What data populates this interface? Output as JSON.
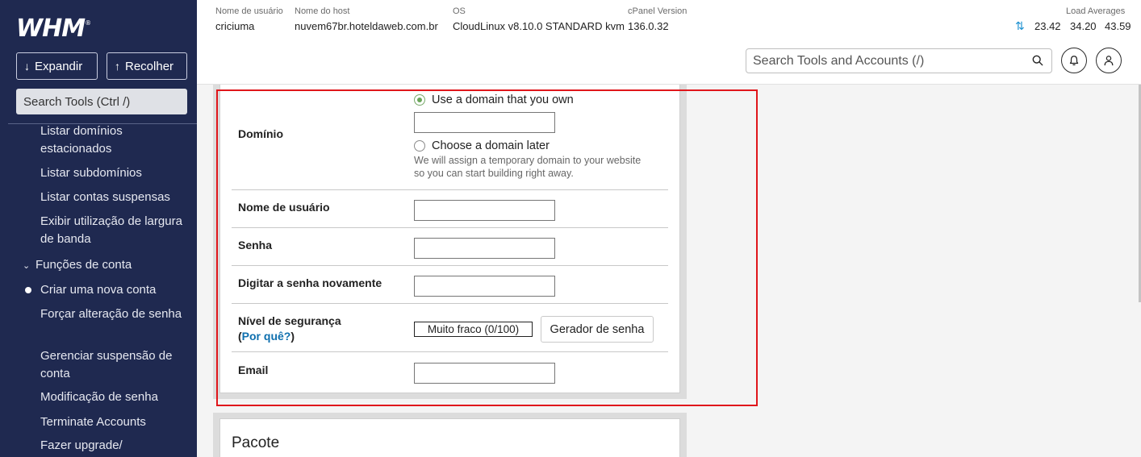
{
  "sidebar": {
    "logo": "WHM",
    "expand_label": "Expandir",
    "collapse_label": "Recolher",
    "search_label": "Search Tools (Ctrl /)",
    "items": [
      {
        "label": "Listar domínios estacionados"
      },
      {
        "label": "Listar subdomínios"
      },
      {
        "label": "Listar contas suspensas"
      },
      {
        "label": "Exibir utilização de largura de banda"
      },
      {
        "label": "Funções de conta"
      },
      {
        "label": "Criar uma nova conta"
      },
      {
        "label": "Forçar alteração de senha"
      },
      {
        "label": "Gerenciar suspensão de conta"
      },
      {
        "label": "Modificação de senha"
      },
      {
        "label": "Terminate Accounts"
      },
      {
        "label": "Fazer upgrade/"
      }
    ]
  },
  "topbar": {
    "username_label": "Nome de usuário",
    "username": "criciuma",
    "host_label": "Nome do host",
    "host": "nuvem67br.hoteldaweb.com.br",
    "os_label": "OS",
    "os": "CloudLinux v8.10.0 STANDARD kvm",
    "cpanel_label": "cPanel Version",
    "cpanel_version": "136.0.32",
    "load_label": "Load Averages",
    "load_1": "23.42",
    "load_5": "34.20",
    "load_15": "43.59"
  },
  "header": {
    "search_placeholder": "Search Tools and Accounts (/)"
  },
  "form": {
    "domain_label": "Domínio",
    "radio_own": "Use a domain that you own",
    "radio_later": "Choose a domain later",
    "hint_line1": "We will assign a temporary domain to your website",
    "hint_line2": "so you can start building right away.",
    "username_label": "Nome de usuário",
    "password_label": "Senha",
    "password_again_label": "Digitar a senha novamente",
    "strength_label": "Nível de segurança",
    "why_prefix": "(",
    "why_link": "Por quê?",
    "why_suffix": ")",
    "strength_value": "Muito fraco (0/100)",
    "generator_button": "Gerador de senha",
    "email_label": "Email",
    "domain_value": "",
    "username_value": "",
    "password_value": "",
    "password_again_value": "",
    "email_value": ""
  },
  "package": {
    "title": "Pacote"
  },
  "colors": {
    "sidebar_bg": "#1f2950",
    "highlight": "#e0161b",
    "link": "#0e6fae",
    "radio_checked": "#6aa55a"
  }
}
